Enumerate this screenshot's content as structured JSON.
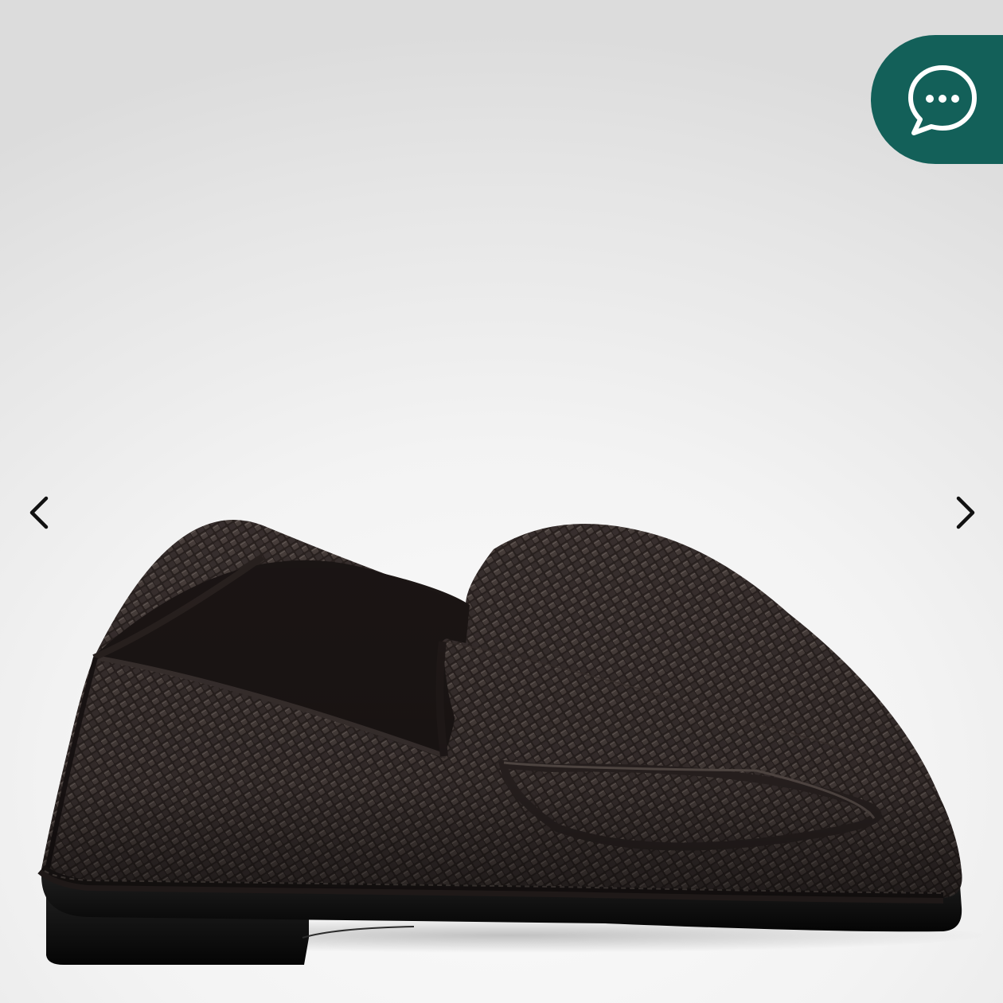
{
  "viewer": {
    "background": "#f3f3f3",
    "product": {
      "subject": "woven-leather-loafer",
      "upper_color": "#2f2624",
      "sole_color": "#0d0d0d"
    },
    "prev_icon": "chevron-left-icon",
    "next_icon": "chevron-right-icon"
  },
  "chat_widget": {
    "icon": "chat-bubble-icon",
    "color": "#136059",
    "icon_color": "#ffffff"
  }
}
